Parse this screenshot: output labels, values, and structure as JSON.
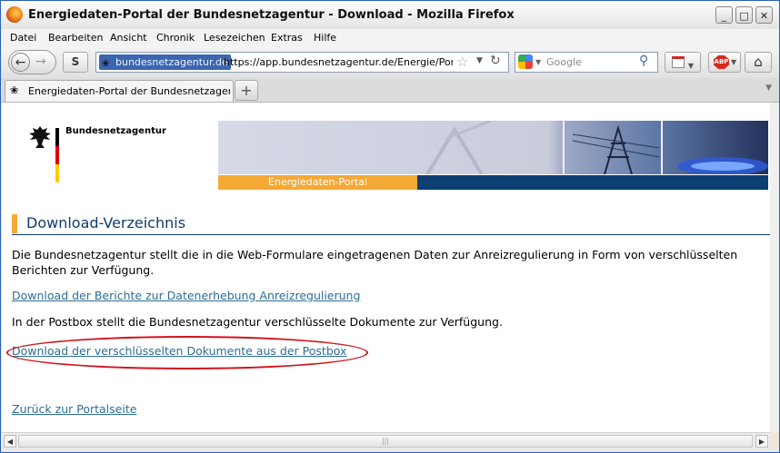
{
  "window": {
    "title": "Energiedaten-Portal der Bundesnetzagentur - Download - Mozilla Firefox",
    "controls": {
      "minimize": "_",
      "maximize": "□",
      "close": "✕"
    }
  },
  "menu": [
    "Datei",
    "Bearbeiten",
    "Ansicht",
    "Chronik",
    "Lesezeichen",
    "Extras",
    "Hilfe"
  ],
  "nav": {
    "identity_domain": "bundesnetzagentur.de",
    "url": "https://app.bundesnetzagentur.de/Energie/Portal/Download.aspx",
    "search_placeholder": "Google",
    "abp_label": "ABP"
  },
  "tabs": [
    {
      "label": "Energiedaten-Portal der Bundesnetzagentur..."
    }
  ],
  "page": {
    "brand_name": "Bundesnetzagentur",
    "portal_label": "Energiedaten-Portal",
    "heading": "Download-Verzeichnis",
    "intro_text": "Die Bundesnetzagentur stellt die in die Web-Formulare eingetragenen Daten zur Anreizregulierung in Form von verschlüsselten Berichten zur Verfügung.",
    "link_reports": "Download der Berichte zur Datenerhebung Anreizregulierung",
    "postbox_text": "In der Postbox stellt die Bundesnetzagentur verschlüsselte Dokumente zur Verfügung.",
    "link_postbox": "Download der verschlüsselten Dokumente aus der Postbox",
    "link_back": "Zurück zur Portalseite"
  },
  "colors": {
    "accent_orange": "#f4a934",
    "brand_blue": "#0d3e74",
    "link": "#2d6e95",
    "annotation_red": "#d0141e"
  }
}
